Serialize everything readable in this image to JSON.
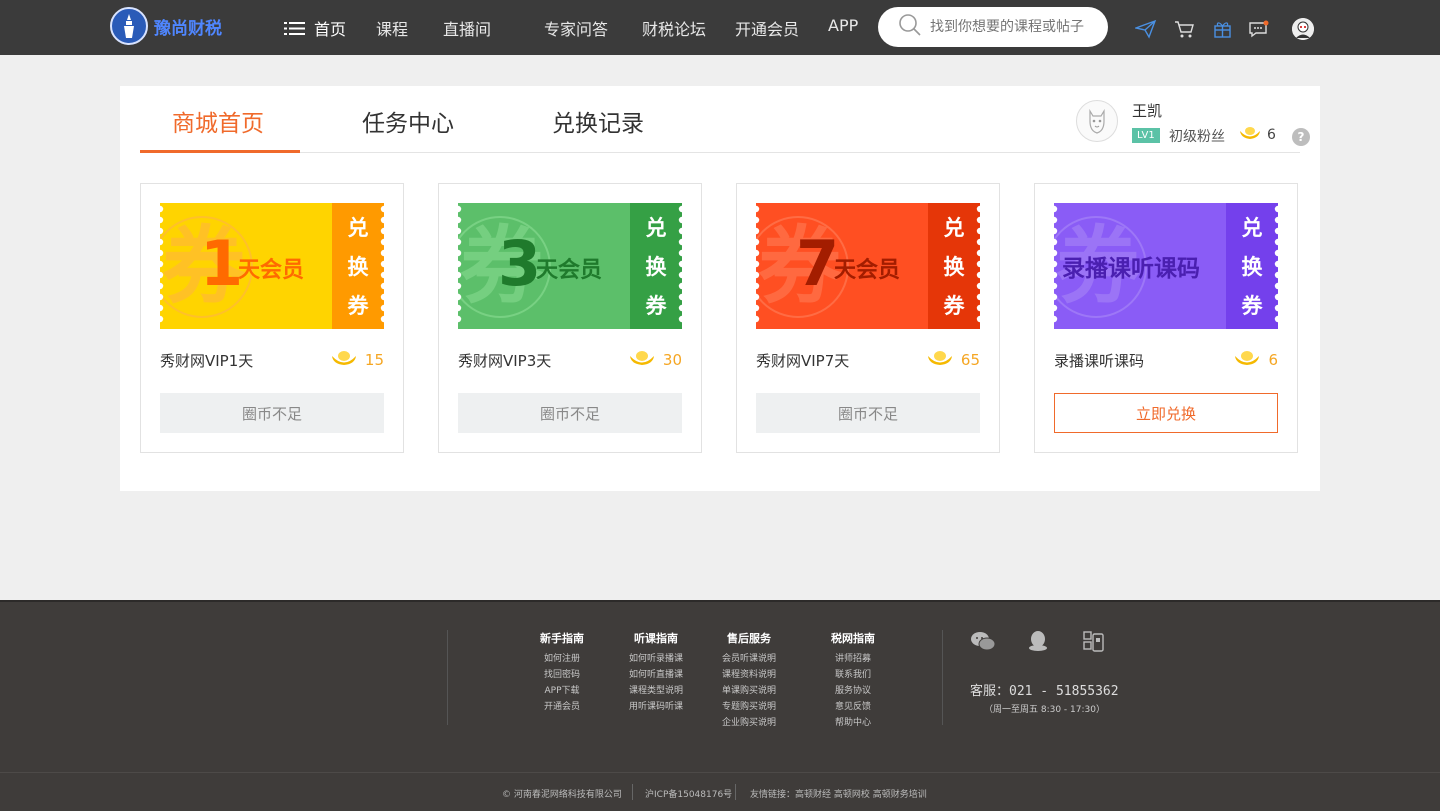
{
  "header": {
    "logo_text": "豫尚财税",
    "nav": [
      "首页",
      "课程",
      "直播间",
      "专家问答",
      "财税论坛",
      "开通会员",
      "APP"
    ],
    "search_placeholder": "找到你想要的课程或帖子"
  },
  "tabs": [
    "商城首页",
    "任务中心",
    "兑换记录"
  ],
  "user": {
    "name": "王凯",
    "level": "LV1",
    "level_name": "初级粉丝",
    "coins": "6",
    "help": "?"
  },
  "cards": [
    {
      "number": "1",
      "ticket_text": "天会员",
      "side_text": [
        "兑",
        "换",
        "券"
      ],
      "watermark": "券",
      "name": "秀财网VIP1天",
      "price": "15",
      "button": "圈币不足",
      "colors": {
        "main": "#ffd400",
        "side": "#ff9a00",
        "num": "#ff6a00",
        "text": "#ff6a00",
        "wm": "#ffc02a"
      }
    },
    {
      "number": "3",
      "ticket_text": "天会员",
      "side_text": [
        "兑",
        "换",
        "券"
      ],
      "watermark": "券",
      "name": "秀财网VIP3天",
      "price": "30",
      "button": "圈币不足",
      "colors": {
        "main": "#5cbf6a",
        "side": "#35a045",
        "num": "#1f7a2c",
        "text": "#1f7a2c",
        "wm": "#78d183"
      }
    },
    {
      "number": "7",
      "ticket_text": "天会员",
      "side_text": [
        "兑",
        "换",
        "券"
      ],
      "watermark": "券",
      "name": "秀财网VIP7天",
      "price": "65",
      "button": "圈币不足",
      "colors": {
        "main": "#ff4f22",
        "side": "#e53608",
        "num": "#a31d00",
        "text": "#a31d00",
        "wm": "#ff6c44"
      }
    },
    {
      "number": "",
      "ticket_text": "录播课听课码",
      "side_text": [
        "兑",
        "换",
        "券"
      ],
      "watermark": "券",
      "name": "录播课听课码",
      "price": "6",
      "button": "立即兑换",
      "colors": {
        "main": "#8a5cf6",
        "side": "#7440ec",
        "num": "#4a1fb0",
        "text": "#4a1fb0",
        "wm": "#9d77f7"
      }
    }
  ],
  "footer": {
    "columns": [
      {
        "title": "新手指南",
        "links": [
          "如何注册",
          "找回密码",
          "APP下载",
          "开通会员"
        ]
      },
      {
        "title": "听课指南",
        "links": [
          "如何听录播课",
          "如何听直播课",
          "课程类型说明",
          "用听课码听课"
        ]
      },
      {
        "title": "售后服务",
        "links": [
          "会员听课说明",
          "课程资料说明",
          "单课购买说明",
          "专题购买说明",
          "企业购买说明"
        ]
      },
      {
        "title": "税网指南",
        "links": [
          "讲师招募",
          "联系我们",
          "服务协议",
          "意见反馈",
          "帮助中心"
        ]
      }
    ],
    "hotline": "客服：021 - 51855362",
    "hours": "（周一至周五  8:30 - 17:30）",
    "copyright": "© 河南春泥网络科技有限公司",
    "icp": "沪ICP备15048176号",
    "links": "友情链接：高顿财经  高顿网校  高顿财务培训"
  }
}
